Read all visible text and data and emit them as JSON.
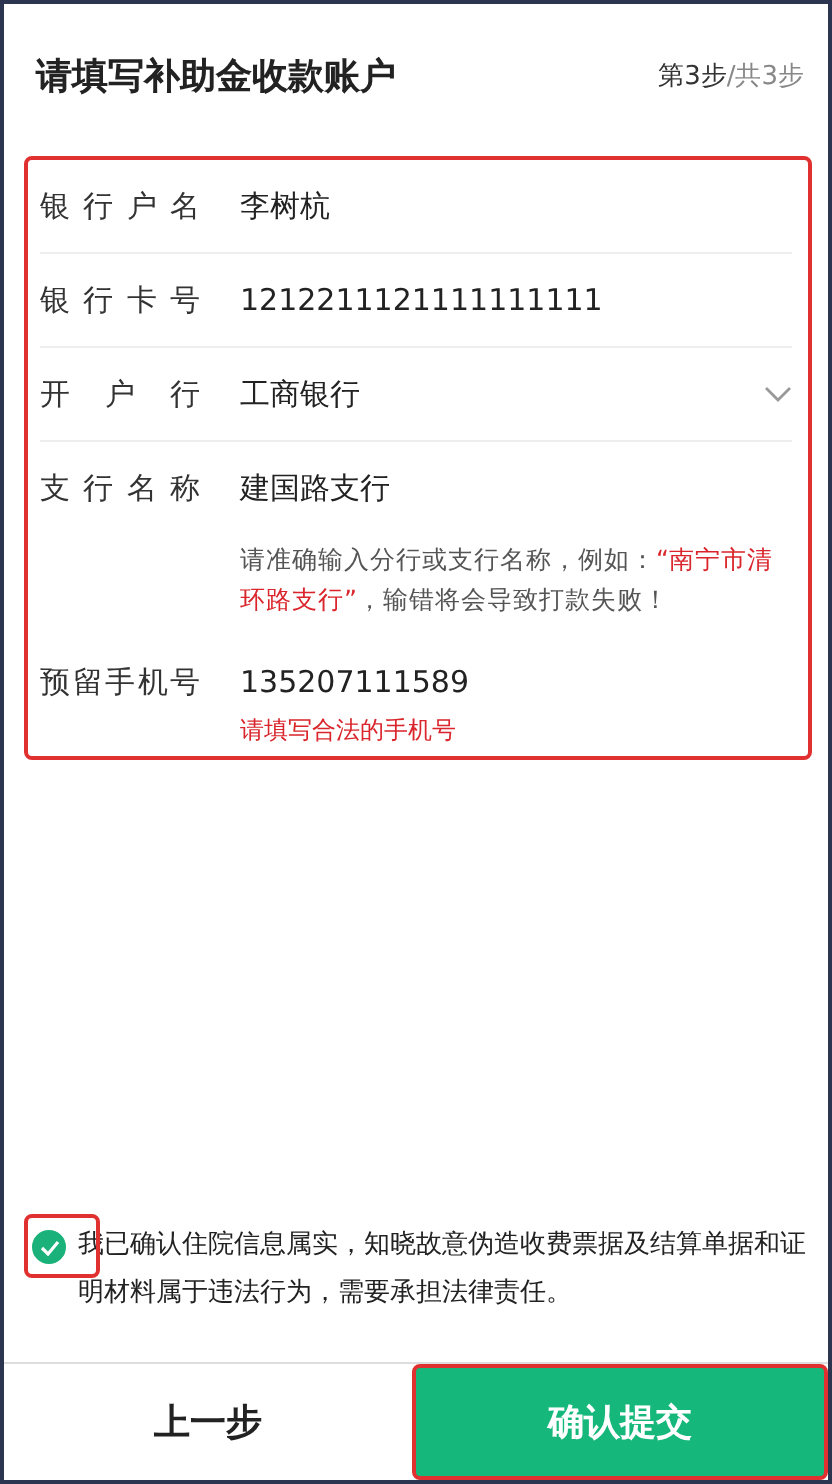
{
  "header": {
    "title": "请填写补助金收款账户",
    "step_current": "第3步",
    "step_total": "/共3步"
  },
  "form": {
    "highlighted": true,
    "fields": [
      {
        "label": "银行户名",
        "value": "李树杭",
        "kind": "text"
      },
      {
        "label": "银行卡号",
        "value": "1212211121111111111",
        "kind": "text"
      },
      {
        "label": "开户行",
        "value": "工商银行",
        "kind": "select"
      },
      {
        "label": "支行名称",
        "value": "建国路支行",
        "kind": "text",
        "hint": [
          {
            "text": "请准确输入分行或支行名称，例如：",
            "emphasis": false
          },
          {
            "text": "“南宁市清环路支行”",
            "emphasis": true
          },
          {
            "text": "，输错将会导致打款失败！",
            "emphasis": false
          }
        ]
      },
      {
        "label": "预留手机号",
        "value": "135207111589",
        "kind": "text",
        "error": "请填写合法的手机号"
      }
    ]
  },
  "agreement": {
    "checked": true,
    "highlighted": true,
    "text": "我已确认住院信息属实，知晓故意伪造收费票据及结算单据和证明材料属于违法行为，需要承担法律责任。"
  },
  "footer": {
    "back": "上一步",
    "submit": "确认提交",
    "submit_highlighted": true
  }
}
